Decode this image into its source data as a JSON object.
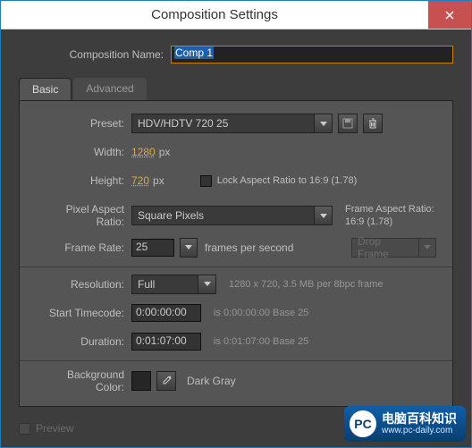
{
  "window": {
    "title": "Composition Settings"
  },
  "compName": {
    "label": "Composition Name:",
    "value": "Comp 1"
  },
  "tabs": {
    "basic": "Basic",
    "advanced": "Advanced"
  },
  "preset": {
    "label": "Preset:",
    "value": "HDV/HDTV 720 25"
  },
  "width": {
    "label": "Width:",
    "value": "1280",
    "unit": "px"
  },
  "height": {
    "label": "Height:",
    "value": "720",
    "unit": "px"
  },
  "lockAspect": {
    "label": "Lock Aspect Ratio to 16:9 (1.78)"
  },
  "pixelAspect": {
    "label": "Pixel Aspect Ratio:",
    "value": "Square Pixels"
  },
  "frameAspect": {
    "label": "Frame Aspect Ratio:",
    "value": "16:9 (1.78)"
  },
  "frameRate": {
    "label": "Frame Rate:",
    "value": "25",
    "unit": "frames per second",
    "dropFrame": "Drop Frame"
  },
  "resolution": {
    "label": "Resolution:",
    "value": "Full",
    "info": "1280 x 720, 3.5 MB per 8bpc frame"
  },
  "startTimecode": {
    "label": "Start Timecode:",
    "value": "0:00:00:00",
    "info": "is 0:00:00:00  Base 25"
  },
  "duration": {
    "label": "Duration:",
    "value": "0:01:07:00",
    "info": "is 0:01:07:00  Base 25"
  },
  "bgColor": {
    "label": "Background Color:",
    "name": "Dark Gray",
    "hex": "#262626"
  },
  "preview": {
    "label": "Preview"
  },
  "watermark": {
    "cn": "电脑百科知识",
    "url": "www.pc-daily.com"
  }
}
